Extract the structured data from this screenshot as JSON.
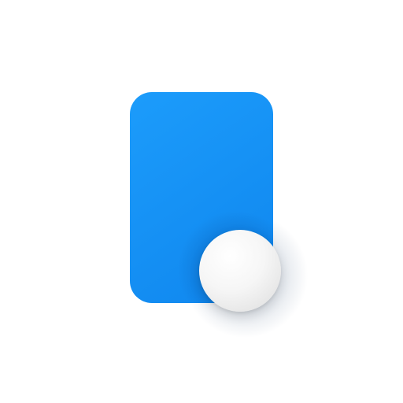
{
  "icon": {
    "name": "app-icon",
    "colors": {
      "card_light": "#1c9cfb",
      "card_dark": "#0f86ee",
      "circle_light": "#ffffff",
      "circle_dark": "#dcdcdc",
      "background": "#ffffff"
    }
  }
}
